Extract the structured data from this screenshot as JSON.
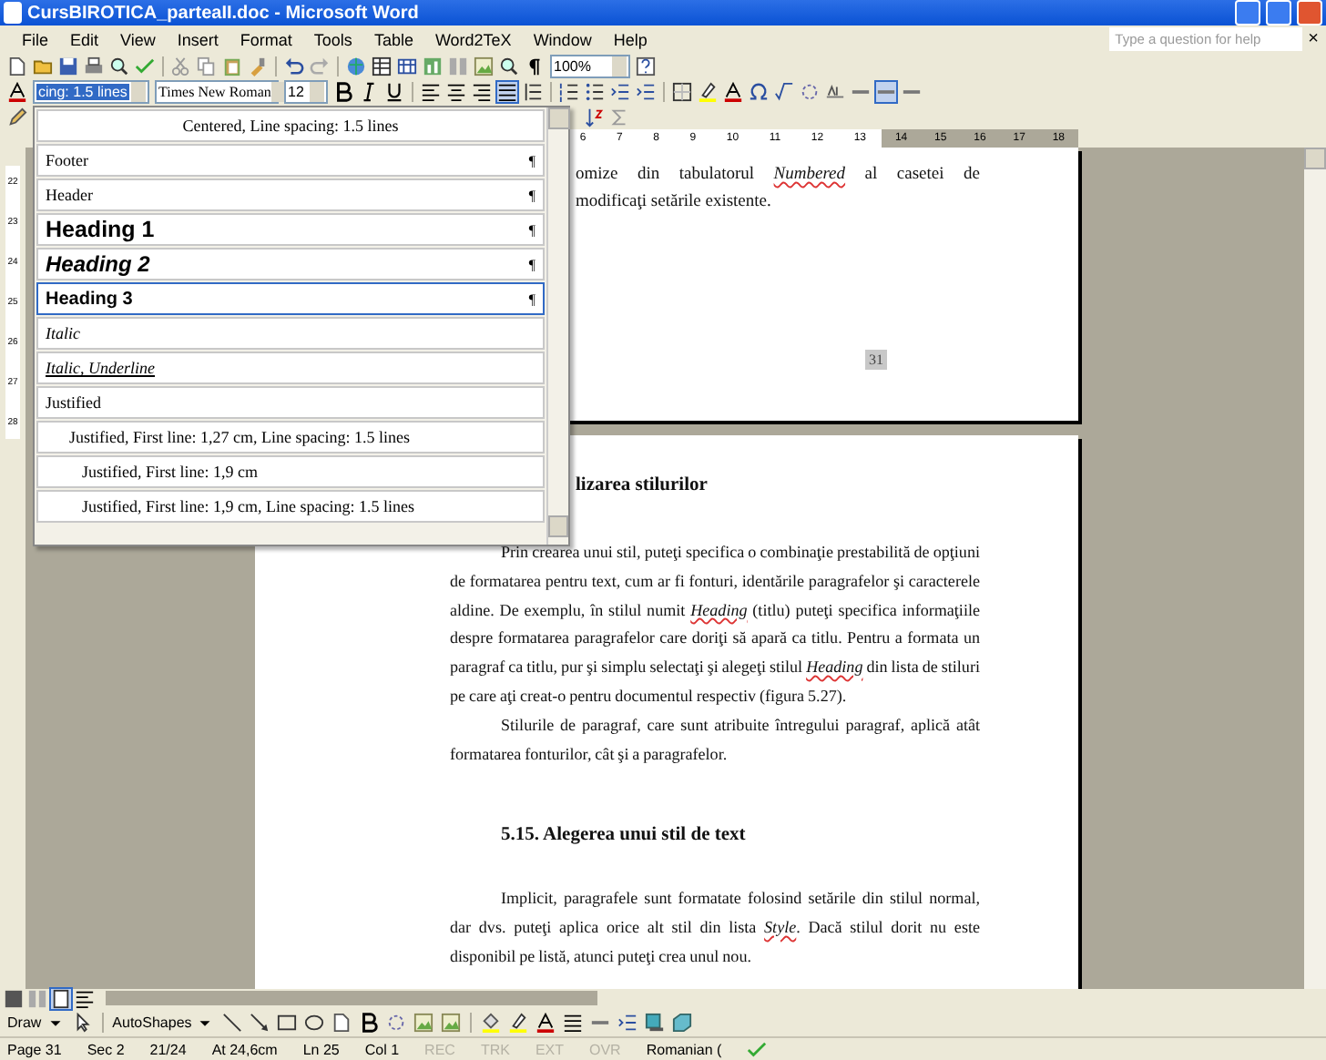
{
  "window": {
    "title": "CursBIROTICA_parteaII.doc - Microsoft Word"
  },
  "menu": [
    {
      "label": "File"
    },
    {
      "label": "Edit"
    },
    {
      "label": "View"
    },
    {
      "label": "Insert"
    },
    {
      "label": "Format"
    },
    {
      "label": "Tools"
    },
    {
      "label": "Table"
    },
    {
      "label": "Word2TeX"
    },
    {
      "label": "Window"
    },
    {
      "label": "Help"
    }
  ],
  "help_box": {
    "placeholder": "Type a question for help",
    "close": "×"
  },
  "standard_toolbar": {
    "zoom": "100%"
  },
  "formatting_toolbar": {
    "style": "cing:  1.5 lines",
    "font": "Times New Roman",
    "size": "12"
  },
  "style_list": [
    {
      "label": "Centered, Line spacing:  1.5 lines",
      "kind": "centered",
      "selected": false
    },
    {
      "label": "Footer",
      "kind": "plain",
      "mark": "¶",
      "selected": false
    },
    {
      "label": "Header",
      "kind": "plain",
      "mark": "¶",
      "selected": false
    },
    {
      "label": "Heading 1",
      "kind": "h1",
      "mark": "¶",
      "selected": false
    },
    {
      "label": "Heading 2",
      "kind": "h2",
      "mark": "¶",
      "selected": false
    },
    {
      "label": "Heading 3",
      "kind": "h3",
      "mark": "¶",
      "selected": true
    },
    {
      "label": "Italic",
      "kind": "italic",
      "selected": false
    },
    {
      "label": "Italic, Underline",
      "kind": "italic_underline",
      "selected": false
    },
    {
      "label": "Justified",
      "kind": "plain",
      "selected": false
    },
    {
      "label": "Justified, First line:  1,27 cm, Line spacing:  1.5 lines",
      "kind": "indent",
      "selected": false
    },
    {
      "label": "Justified, First line:  1,9 cm",
      "kind": "indent_more",
      "selected": false
    },
    {
      "label": "Justified, First line:  1,9 cm, Line spacing:  1.5 lines",
      "kind": "indent_more",
      "selected": false
    }
  ],
  "ruler": {
    "labels": [
      "6",
      "7",
      "8",
      "9",
      "10",
      "11",
      "12",
      "13",
      "14",
      "15",
      "16",
      "17",
      "18"
    ]
  },
  "vertical_ruler": {
    "labels": [
      "22",
      "23",
      "24",
      "25",
      "26",
      "27",
      "28"
    ]
  },
  "page_1": {
    "lines": [
      "omize din tabulatorul *Numbered* al casetei de",
      "modificaţi setările existente."
    ],
    "page_number": "31"
  },
  "page_2": {
    "blocks": [
      {
        "kind": "heading",
        "text": "lizarea stilurilor"
      },
      {
        "kind": "paragraph",
        "text": "Prin crearea unui stil, puteţi specifica o combinaţie prestabilită de opţiuni de formatarea pentru text, cum ar fi fonturi, identările paragrafelor şi caracterele aldine. De exemplu, în stilul numit *Heading* (titlu) puteţi specifica informaţiile despre formatarea paragrafelor care doriţi să apară ca titlu. Pentru a formata un paragraf ca titlu, pur şi simplu selectaţi şi alegeţi stilul *Heading* din lista de stiluri pe care aţi creat-o pentru documentul respectiv (figura 5.27)."
      },
      {
        "kind": "paragraph",
        "text": "Stilurile de paragraf, care sunt atribuite întregului paragraf, aplică atât formatarea fonturilor, cât şi a paragrafelor."
      },
      {
        "kind": "section_heading",
        "text": "5.15. Alegerea unui stil de text"
      },
      {
        "kind": "paragraph",
        "text": "Implicit, paragrafele sunt formatate folosind setările din stilul normal, dar dvs. puteţi aplica orice alt stil din lista *Style*. Dacă stilul dorit nu este disponibil pe listă, atunci puteţi crea unul nou."
      }
    ]
  },
  "drawing_toolbar": {
    "draw": "Draw",
    "autoshapes": "AutoShapes"
  },
  "status_bar": [
    {
      "text": "Page 31",
      "disabled": false
    },
    {
      "text": "Sec 2",
      "disabled": false
    },
    {
      "text": "21/24",
      "disabled": false
    },
    {
      "text": "At 24,6cm",
      "disabled": false
    },
    {
      "text": "Ln 25",
      "disabled": false
    },
    {
      "text": "Col 1",
      "disabled": false
    },
    {
      "text": "REC",
      "disabled": true
    },
    {
      "text": "TRK",
      "disabled": true
    },
    {
      "text": "EXT",
      "disabled": true
    },
    {
      "text": "OVR",
      "disabled": true
    },
    {
      "text": "Romanian (",
      "disabled": false
    }
  ]
}
